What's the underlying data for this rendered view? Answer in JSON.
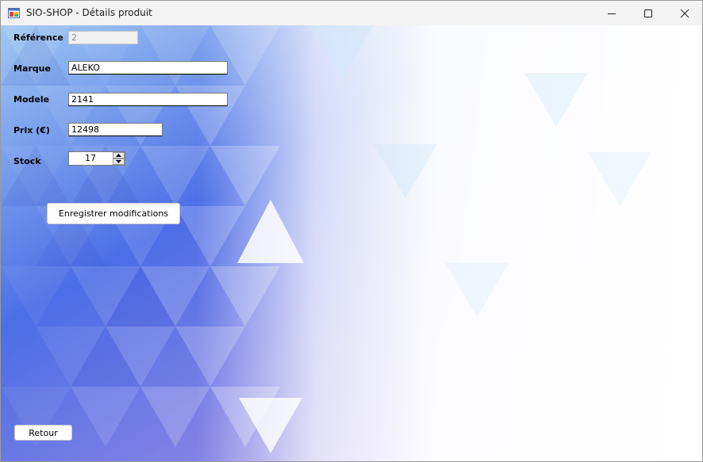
{
  "window": {
    "title": "SIO-SHOP - Détails produit"
  },
  "form": {
    "reference_label": "Référence",
    "reference_value": "2",
    "marque_label": "Marque",
    "marque_value": "ALEKO",
    "modele_label": "Modele",
    "modele_value": "2141",
    "prix_label": "Prix (€)",
    "prix_value": "12498",
    "stock_label": "Stock",
    "stock_value": "17"
  },
  "actions": {
    "save_label": "Enregistrer modifications",
    "back_label": "Retour"
  },
  "icons": {
    "app": "app-window-icon",
    "minimize": "minimize-icon",
    "maximize": "maximize-icon",
    "close": "close-icon",
    "spin_up": "chevron-up-icon",
    "spin_down": "chevron-down-icon"
  },
  "colors": {
    "titlebar": "#f3f3f3",
    "gradient_blue": "#3f5fe0",
    "gradient_purple": "#9b7ae0",
    "triangle_light": "#cfe8fb"
  }
}
